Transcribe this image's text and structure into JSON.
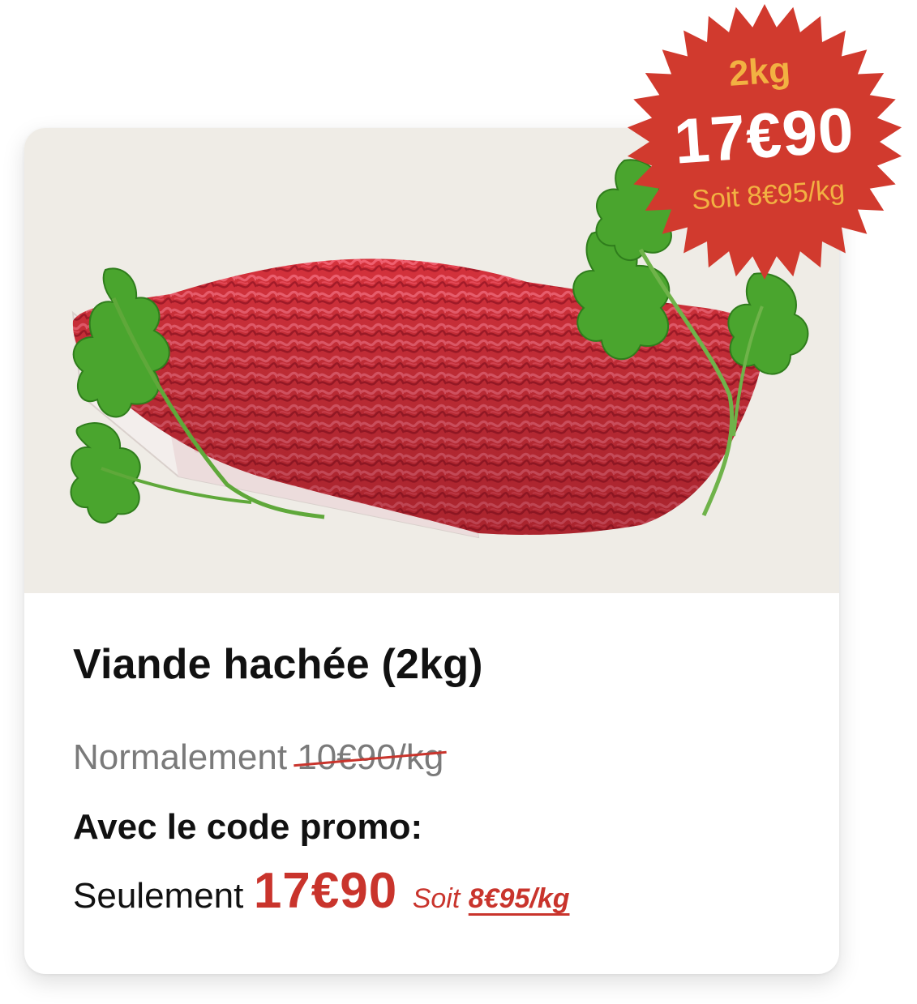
{
  "product": {
    "title": "Viande hachée (2kg)",
    "image_alt": "Viande hachée avec persil",
    "normal_label": "Normalement",
    "normal_price": "10€90/kg",
    "promo_heading": "Avec le code promo:",
    "final_label": "Seulement",
    "final_price": "17€90",
    "per_kg_prefix": "Soit",
    "per_kg_value": "8€95/kg"
  },
  "badge": {
    "weight": "2kg",
    "price": "17€90",
    "per_kg": "Soit 8€95/kg"
  },
  "colors": {
    "accent_red": "#c9342c",
    "badge_red": "#d13a2e",
    "badge_yellow": "#f2b142",
    "photo_bg": "#efece6",
    "text_dark": "#111111",
    "text_muted": "#7a7a7a"
  },
  "icons": {
    "badge_shape": "starburst-badge-icon",
    "leaf": "parsley-leaf-icon"
  }
}
